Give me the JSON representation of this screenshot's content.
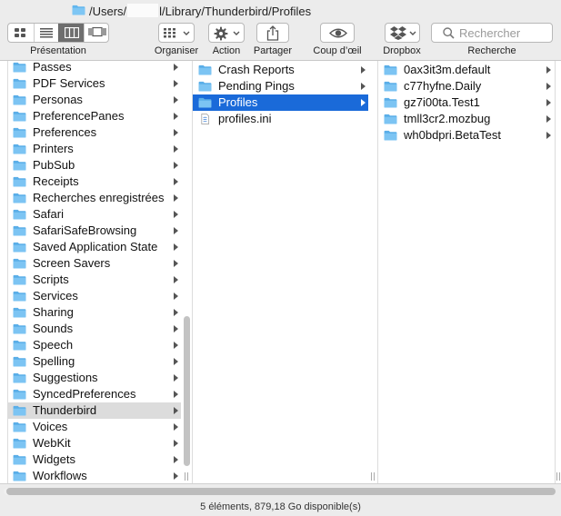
{
  "window": {
    "path_prefix": "/Users/",
    "path_suffix": "l/Library/Thunderbird/Profiles"
  },
  "toolbar": {
    "view_label": "Présentation",
    "organize_label": "Organiser",
    "action_label": "Action",
    "share_label": "Partager",
    "quicklook_label": "Coup d’œil",
    "dropbox_label": "Dropbox",
    "search_label": "Recherche"
  },
  "search": {
    "placeholder": "Rechercher"
  },
  "colors": {
    "selection": "#1a6ad9",
    "folder": "#62b6ee",
    "parent_highlight": "#dcdcdc"
  },
  "columns": [
    {
      "items": [
        {
          "label": "Passes",
          "type": "folder",
          "chevron": true
        },
        {
          "label": "PDF Services",
          "type": "folder",
          "chevron": true
        },
        {
          "label": "Personas",
          "type": "folder",
          "chevron": true
        },
        {
          "label": "PreferencePanes",
          "type": "folder",
          "chevron": true
        },
        {
          "label": "Preferences",
          "type": "folder",
          "chevron": true
        },
        {
          "label": "Printers",
          "type": "folder",
          "chevron": true
        },
        {
          "label": "PubSub",
          "type": "folder",
          "chevron": true
        },
        {
          "label": "Receipts",
          "type": "folder",
          "chevron": true
        },
        {
          "label": "Recherches enregistrées",
          "type": "folder",
          "chevron": true
        },
        {
          "label": "Safari",
          "type": "folder",
          "chevron": true
        },
        {
          "label": "SafariSafeBrowsing",
          "type": "folder",
          "chevron": true
        },
        {
          "label": "Saved Application State",
          "type": "folder",
          "chevron": true
        },
        {
          "label": "Screen Savers",
          "type": "folder",
          "chevron": true
        },
        {
          "label": "Scripts",
          "type": "folder",
          "chevron": true
        },
        {
          "label": "Services",
          "type": "folder",
          "chevron": true
        },
        {
          "label": "Sharing",
          "type": "folder",
          "chevron": true
        },
        {
          "label": "Sounds",
          "type": "folder",
          "chevron": true
        },
        {
          "label": "Speech",
          "type": "folder",
          "chevron": true
        },
        {
          "label": "Spelling",
          "type": "folder",
          "chevron": true
        },
        {
          "label": "Suggestions",
          "type": "folder",
          "chevron": true
        },
        {
          "label": "SyncedPreferences",
          "type": "folder",
          "chevron": true
        },
        {
          "label": "Thunderbird",
          "type": "folder",
          "chevron": true,
          "state": "parent"
        },
        {
          "label": "Voices",
          "type": "folder",
          "chevron": true
        },
        {
          "label": "WebKit",
          "type": "folder",
          "chevron": true
        },
        {
          "label": "Widgets",
          "type": "folder",
          "chevron": true
        },
        {
          "label": "Workflows",
          "type": "folder",
          "chevron": true
        }
      ]
    },
    {
      "items": [
        {
          "label": "Crash Reports",
          "type": "folder",
          "chevron": true
        },
        {
          "label": "Pending Pings",
          "type": "folder",
          "chevron": true
        },
        {
          "label": "Profiles",
          "type": "folder",
          "chevron": true,
          "state": "selected"
        },
        {
          "label": "profiles.ini",
          "type": "file",
          "chevron": false
        }
      ]
    },
    {
      "items": [
        {
          "label": "0ax3it3m.default",
          "type": "folder",
          "chevron": true
        },
        {
          "label": "c77hyfne.Daily",
          "type": "folder",
          "chevron": true
        },
        {
          "label": "gz7i00ta.Test1",
          "type": "folder",
          "chevron": true
        },
        {
          "label": "tmll3cr2.mozbug",
          "type": "folder",
          "chevron": true
        },
        {
          "label": "wh0bdpri.BetaTest",
          "type": "folder",
          "chevron": true
        }
      ]
    }
  ],
  "status": {
    "text": "5 éléments, 879,18 Go disponible(s)"
  }
}
